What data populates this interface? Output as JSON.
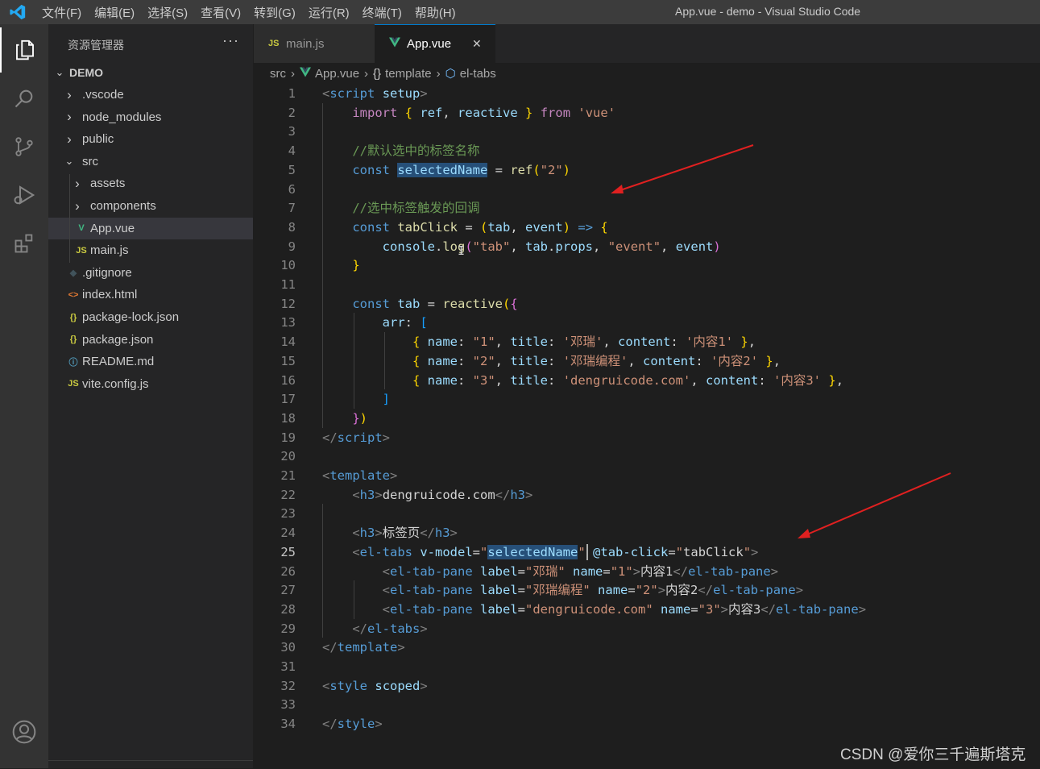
{
  "titlebar": {
    "menu": [
      "文件(F)",
      "编辑(E)",
      "选择(S)",
      "查看(V)",
      "转到(G)",
      "运行(R)",
      "终端(T)",
      "帮助(H)"
    ],
    "window_title": "App.vue - demo - Visual Studio Code"
  },
  "activity_bar": {
    "items": [
      "explorer-icon",
      "search-icon",
      "source-control-icon",
      "run-debug-icon",
      "extensions-icon"
    ],
    "bottom": [
      "account-icon"
    ]
  },
  "explorer": {
    "header": "资源管理器",
    "more": "···",
    "root": "DEMO",
    "items": [
      {
        "label": ".vscode",
        "type": "folder",
        "open": false
      },
      {
        "label": "node_modules",
        "type": "folder",
        "open": false
      },
      {
        "label": "public",
        "type": "folder",
        "open": false
      },
      {
        "label": "src",
        "type": "folder",
        "open": true
      },
      {
        "label": "assets",
        "type": "folder",
        "open": false
      },
      {
        "label": "components",
        "type": "folder",
        "open": false
      },
      {
        "label": "App.vue",
        "type": "vue",
        "selected": true
      },
      {
        "label": "main.js",
        "type": "js"
      },
      {
        "label": ".gitignore",
        "type": "git"
      },
      {
        "label": "index.html",
        "type": "html"
      },
      {
        "label": "package-lock.json",
        "type": "json"
      },
      {
        "label": "package.json",
        "type": "json"
      },
      {
        "label": "README.md",
        "type": "info"
      },
      {
        "label": "vite.config.js",
        "type": "js"
      }
    ]
  },
  "tabs": [
    {
      "label": "main.js",
      "icon": "JS",
      "active": false
    },
    {
      "label": "App.vue",
      "icon": "V",
      "active": true,
      "close": "✕"
    }
  ],
  "breadcrumb": [
    "src",
    "App.vue",
    "template",
    "el-tabs"
  ],
  "breadcrumb_icons": [
    "",
    "V",
    "{}",
    "⬡"
  ],
  "editor": {
    "current_line": 25,
    "lines": [
      [
        [
          "br",
          "<"
        ],
        [
          "tg",
          "script"
        ],
        [
          "pn",
          " "
        ],
        [
          "vr",
          "setup"
        ],
        [
          "br",
          ">"
        ]
      ],
      [
        [
          "pn",
          "    "
        ],
        [
          "kp",
          "import"
        ],
        [
          "pn",
          " "
        ],
        [
          "b1",
          "{"
        ],
        [
          "pn",
          " "
        ],
        [
          "vr",
          "ref"
        ],
        [
          "pn",
          ", "
        ],
        [
          "vr",
          "reactive"
        ],
        [
          "pn",
          " "
        ],
        [
          "b1",
          "}"
        ],
        [
          "pn",
          " "
        ],
        [
          "kp",
          "from"
        ],
        [
          "pn",
          " "
        ],
        [
          "st",
          "'vue'"
        ]
      ],
      [],
      [
        [
          "pn",
          "    "
        ],
        [
          "cm",
          "//默认选中的标签名称"
        ]
      ],
      [
        [
          "pn",
          "    "
        ],
        [
          "kw",
          "const"
        ],
        [
          "pn",
          " "
        ],
        [
          "hlvr",
          "selectedName"
        ],
        [
          "pn",
          " = "
        ],
        [
          "fn",
          "ref"
        ],
        [
          "b1",
          "("
        ],
        [
          "st",
          "\"2\""
        ],
        [
          "b1",
          ")"
        ]
      ],
      [],
      [
        [
          "pn",
          "    "
        ],
        [
          "cm",
          "//选中标签触发的回调"
        ]
      ],
      [
        [
          "pn",
          "    "
        ],
        [
          "kw",
          "const"
        ],
        [
          "pn",
          " "
        ],
        [
          "fn",
          "tabClick"
        ],
        [
          "pn",
          " = "
        ],
        [
          "b1",
          "("
        ],
        [
          "vr",
          "tab"
        ],
        [
          "pn",
          ", "
        ],
        [
          "vr",
          "event"
        ],
        [
          "b1",
          ")"
        ],
        [
          "pn",
          " "
        ],
        [
          "kw",
          "=>"
        ],
        [
          "pn",
          " "
        ],
        [
          "b1",
          "{"
        ]
      ],
      [
        [
          "pn",
          "        "
        ],
        [
          "vr",
          "console"
        ],
        [
          "pn",
          "."
        ],
        [
          "fn",
          "log"
        ],
        [
          "b2",
          "("
        ],
        [
          "st",
          "\"tab\""
        ],
        [
          "pn",
          ", "
        ],
        [
          "vr",
          "tab"
        ],
        [
          "pn",
          "."
        ],
        [
          "vr",
          "props"
        ],
        [
          "pn",
          ", "
        ],
        [
          "st",
          "\"event\""
        ],
        [
          "pn",
          ", "
        ],
        [
          "vr",
          "event"
        ],
        [
          "b2",
          ")"
        ]
      ],
      [
        [
          "pn",
          "    "
        ],
        [
          "b1",
          "}"
        ]
      ],
      [],
      [
        [
          "pn",
          "    "
        ],
        [
          "kw",
          "const"
        ],
        [
          "pn",
          " "
        ],
        [
          "vr",
          "tab"
        ],
        [
          "pn",
          " = "
        ],
        [
          "fn",
          "reactive"
        ],
        [
          "b1",
          "("
        ],
        [
          "b2",
          "{"
        ]
      ],
      [
        [
          "pn",
          "        "
        ],
        [
          "vr",
          "arr"
        ],
        [
          "pn",
          ": "
        ],
        [
          "b3",
          "["
        ]
      ],
      [
        [
          "pn",
          "            "
        ],
        [
          "b1",
          "{"
        ],
        [
          "pn",
          " "
        ],
        [
          "vr",
          "name"
        ],
        [
          "pn",
          ": "
        ],
        [
          "st",
          "\"1\""
        ],
        [
          "pn",
          ", "
        ],
        [
          "vr",
          "title"
        ],
        [
          "pn",
          ": "
        ],
        [
          "st",
          "'邓瑞'"
        ],
        [
          "pn",
          ", "
        ],
        [
          "vr",
          "content"
        ],
        [
          "pn",
          ": "
        ],
        [
          "st",
          "'内容1'"
        ],
        [
          "pn",
          " "
        ],
        [
          "b1",
          "}"
        ],
        [
          "pn",
          ","
        ]
      ],
      [
        [
          "pn",
          "            "
        ],
        [
          "b1",
          "{"
        ],
        [
          "pn",
          " "
        ],
        [
          "vr",
          "name"
        ],
        [
          "pn",
          ": "
        ],
        [
          "st",
          "\"2\""
        ],
        [
          "pn",
          ", "
        ],
        [
          "vr",
          "title"
        ],
        [
          "pn",
          ": "
        ],
        [
          "st",
          "'邓瑞编程'"
        ],
        [
          "pn",
          ", "
        ],
        [
          "vr",
          "content"
        ],
        [
          "pn",
          ": "
        ],
        [
          "st",
          "'内容2'"
        ],
        [
          "pn",
          " "
        ],
        [
          "b1",
          "}"
        ],
        [
          "pn",
          ","
        ]
      ],
      [
        [
          "pn",
          "            "
        ],
        [
          "b1",
          "{"
        ],
        [
          "pn",
          " "
        ],
        [
          "vr",
          "name"
        ],
        [
          "pn",
          ": "
        ],
        [
          "st",
          "\"3\""
        ],
        [
          "pn",
          ", "
        ],
        [
          "vr",
          "title"
        ],
        [
          "pn",
          ": "
        ],
        [
          "st",
          "'dengruicode.com'"
        ],
        [
          "pn",
          ", "
        ],
        [
          "vr",
          "content"
        ],
        [
          "pn",
          ": "
        ],
        [
          "st",
          "'内容3'"
        ],
        [
          "pn",
          " "
        ],
        [
          "b1",
          "}"
        ],
        [
          "pn",
          ","
        ]
      ],
      [
        [
          "pn",
          "        "
        ],
        [
          "b3",
          "]"
        ]
      ],
      [
        [
          "pn",
          "    "
        ],
        [
          "b2",
          "}"
        ],
        [
          "b1",
          ")"
        ]
      ],
      [
        [
          "br",
          "</"
        ],
        [
          "tg",
          "script"
        ],
        [
          "br",
          ">"
        ]
      ],
      [],
      [
        [
          "br",
          "<"
        ],
        [
          "tg",
          "template"
        ],
        [
          "br",
          ">"
        ]
      ],
      [
        [
          "pn",
          "    "
        ],
        [
          "br",
          "<"
        ],
        [
          "tg",
          "h3"
        ],
        [
          "br",
          ">"
        ],
        [
          "pn",
          "dengruicode.com"
        ],
        [
          "br",
          "</"
        ],
        [
          "tg",
          "h3"
        ],
        [
          "br",
          ">"
        ]
      ],
      [],
      [
        [
          "pn",
          "    "
        ],
        [
          "br",
          "<"
        ],
        [
          "tg",
          "h3"
        ],
        [
          "br",
          ">"
        ],
        [
          "pn",
          "标签页"
        ],
        [
          "br",
          "</"
        ],
        [
          "tg",
          "h3"
        ],
        [
          "br",
          ">"
        ]
      ],
      [
        [
          "pn",
          "    "
        ],
        [
          "br",
          "<"
        ],
        [
          "tg",
          "el-tabs"
        ],
        [
          "pn",
          " "
        ],
        [
          "vr",
          "v-model"
        ],
        [
          "pn",
          "="
        ],
        [
          "st",
          "\""
        ],
        [
          "hlst",
          "selectedName"
        ],
        [
          "st",
          "\""
        ],
        [
          "pn",
          " "
        ],
        [
          "vr",
          "@tab-click"
        ],
        [
          "pn",
          "="
        ],
        [
          "st",
          "\""
        ],
        [
          "pn",
          "tabClick"
        ],
        [
          "st",
          "\""
        ],
        [
          "br",
          ">"
        ]
      ],
      [
        [
          "pn",
          "        "
        ],
        [
          "br",
          "<"
        ],
        [
          "tg",
          "el-tab-pane"
        ],
        [
          "pn",
          " "
        ],
        [
          "vr",
          "label"
        ],
        [
          "pn",
          "="
        ],
        [
          "st",
          "\"邓瑞\""
        ],
        [
          "pn",
          " "
        ],
        [
          "vr",
          "name"
        ],
        [
          "pn",
          "="
        ],
        [
          "st",
          "\"1\""
        ],
        [
          "br",
          ">"
        ],
        [
          "pn",
          "内容1"
        ],
        [
          "br",
          "</"
        ],
        [
          "tg",
          "el-tab-pane"
        ],
        [
          "br",
          ">"
        ]
      ],
      [
        [
          "pn",
          "        "
        ],
        [
          "br",
          "<"
        ],
        [
          "tg",
          "el-tab-pane"
        ],
        [
          "pn",
          " "
        ],
        [
          "vr",
          "label"
        ],
        [
          "pn",
          "="
        ],
        [
          "st",
          "\"邓瑞编程\""
        ],
        [
          "pn",
          " "
        ],
        [
          "vr",
          "name"
        ],
        [
          "pn",
          "="
        ],
        [
          "st",
          "\"2\""
        ],
        [
          "br",
          ">"
        ],
        [
          "pn",
          "内容2"
        ],
        [
          "br",
          "</"
        ],
        [
          "tg",
          "el-tab-pane"
        ],
        [
          "br",
          ">"
        ]
      ],
      [
        [
          "pn",
          "        "
        ],
        [
          "br",
          "<"
        ],
        [
          "tg",
          "el-tab-pane"
        ],
        [
          "pn",
          " "
        ],
        [
          "vr",
          "label"
        ],
        [
          "pn",
          "="
        ],
        [
          "st",
          "\"dengruicode.com\""
        ],
        [
          "pn",
          " "
        ],
        [
          "vr",
          "name"
        ],
        [
          "pn",
          "="
        ],
        [
          "st",
          "\"3\""
        ],
        [
          "br",
          ">"
        ],
        [
          "pn",
          "内容3"
        ],
        [
          "br",
          "</"
        ],
        [
          "tg",
          "el-tab-pane"
        ],
        [
          "br",
          ">"
        ]
      ],
      [
        [
          "pn",
          "    "
        ],
        [
          "br",
          "</"
        ],
        [
          "tg",
          "el-tabs"
        ],
        [
          "br",
          ">"
        ]
      ],
      [
        [
          "br",
          "</"
        ],
        [
          "tg",
          "template"
        ],
        [
          "br",
          ">"
        ]
      ],
      [],
      [
        [
          "br",
          "<"
        ],
        [
          "tg",
          "style"
        ],
        [
          "pn",
          " "
        ],
        [
          "vr",
          "scoped"
        ],
        [
          "br",
          ">"
        ]
      ],
      [],
      [
        [
          "br",
          "</"
        ],
        [
          "tg",
          "style"
        ],
        [
          "br",
          ">"
        ]
      ]
    ]
  },
  "colors": {
    "accent": "#007acc",
    "annotation_arrow": "#e02020"
  },
  "watermark": "CSDN @爱你三千遍斯塔克"
}
